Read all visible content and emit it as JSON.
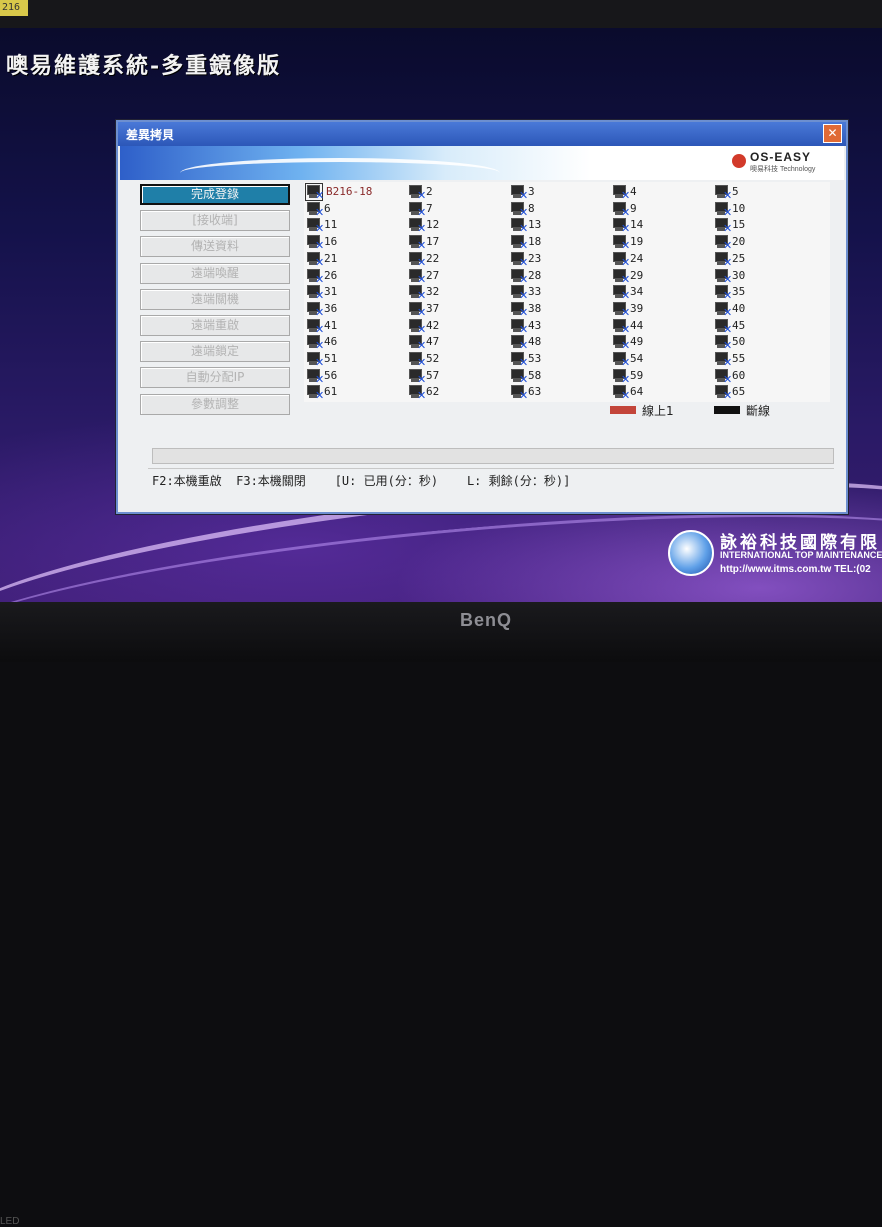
{
  "monitor": {
    "tag": "216",
    "brand": "BenQ",
    "led_label": "LED"
  },
  "screen_title": "噢易維護系統-多重鏡像版",
  "company": {
    "name": "詠裕科技國際有限",
    "english": "INTERNATIONAL TOP MAINTENANCE S",
    "url": "http://www.itms.com.tw TEL:(02"
  },
  "dialog": {
    "title": "差異拷貝",
    "close_glyph": "✕",
    "brand": {
      "name": "OS-EASY",
      "sub": "噢易科技 Technology"
    },
    "menu": [
      {
        "label": "完成登錄",
        "active": true
      },
      {
        "label": "[接收端]",
        "active": false
      },
      {
        "label": "傳送資料",
        "active": false
      },
      {
        "label": "遠端喚醒",
        "active": false
      },
      {
        "label": "遠端關機",
        "active": false
      },
      {
        "label": "遠端重啟",
        "active": false
      },
      {
        "label": "遠端鎖定",
        "active": false
      },
      {
        "label": "自動分配IP",
        "active": false
      },
      {
        "label": "參數調整",
        "active": false
      }
    ],
    "computers": [
      "B216-18",
      "2",
      "3",
      "4",
      "5",
      "6",
      "7",
      "8",
      "9",
      "10",
      "11",
      "12",
      "13",
      "14",
      "15",
      "16",
      "17",
      "18",
      "19",
      "20",
      "21",
      "22",
      "23",
      "24",
      "25",
      "26",
      "27",
      "28",
      "29",
      "30",
      "31",
      "32",
      "33",
      "34",
      "35",
      "36",
      "37",
      "38",
      "39",
      "40",
      "41",
      "42",
      "43",
      "44",
      "45",
      "46",
      "47",
      "48",
      "49",
      "50",
      "51",
      "52",
      "53",
      "54",
      "55",
      "56",
      "57",
      "58",
      "59",
      "60",
      "61",
      "62",
      "63",
      "64",
      "65"
    ],
    "legend": {
      "online_label": "線上1",
      "offline_label": "斷線",
      "online_color": "#c3453a",
      "offline_color": "#111111"
    },
    "progress": 0,
    "status_text": "F2:本機重啟  F3:本機關閉    [U: 已用(分：秒)    L: 剩餘(分：秒)]"
  }
}
